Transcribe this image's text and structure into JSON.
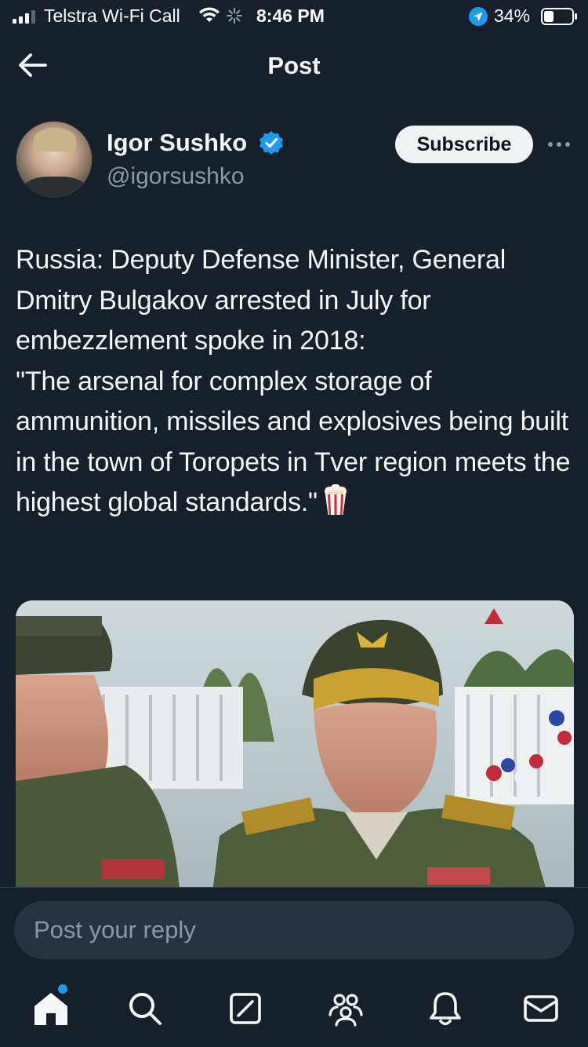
{
  "status_bar": {
    "carrier": "Telstra Wi-Fi Call",
    "time": "8:46 PM",
    "battery_percent": "34%",
    "signal_bars": 3,
    "battery_level": 0.34
  },
  "header": {
    "title": "Post",
    "back_icon": "back-arrow-icon"
  },
  "author": {
    "name": "Igor Sushko",
    "handle": "@igorsushko",
    "verified": true,
    "subscribe_label": "Subscribe"
  },
  "post": {
    "text": "Russia: Deputy Defense Minister, General Dmitry Bulgakov arrested in July for embezzlement spoke in 2018:\n\"The arsenal for complex storage of ammunition, missiles and explosives being built in the town of Toropets in Tver region meets the highest global standards.\"",
    "emoji_icon": "popcorn-icon"
  },
  "reply": {
    "placeholder": "Post your reply"
  },
  "tab_bar": {
    "tabs": [
      "home",
      "search",
      "grok",
      "communities",
      "notifications",
      "messages"
    ],
    "active": "home",
    "home_has_dot": true
  },
  "colors": {
    "background": "#15202b",
    "accent": "#1d9bf0",
    "secondary_text": "#8b98a5",
    "input_bg": "#273340"
  }
}
